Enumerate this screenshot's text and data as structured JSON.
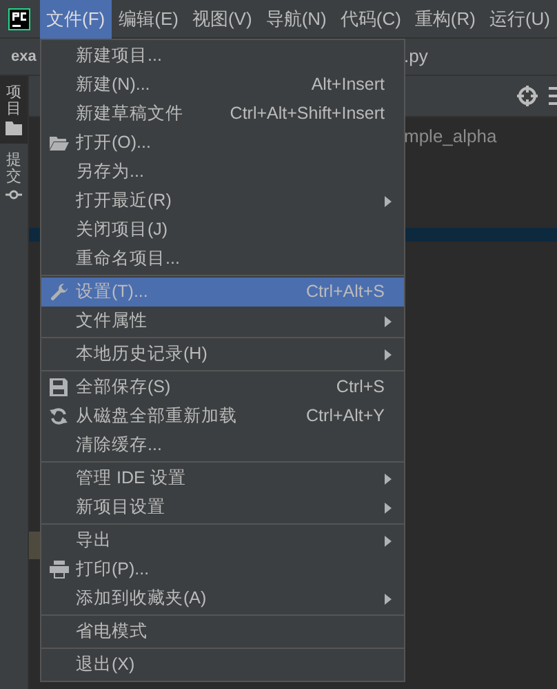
{
  "menu_bar": [
    {
      "label": "文件(F)",
      "selected": true
    },
    {
      "label": "编辑(E)",
      "selected": false
    },
    {
      "label": "视图(V)",
      "selected": false
    },
    {
      "label": "导航(N)",
      "selected": false
    },
    {
      "label": "代码(C)",
      "selected": false
    },
    {
      "label": "重构(R)",
      "selected": false
    },
    {
      "label": "运行(U)",
      "selected": false
    }
  ],
  "editor_tabs": [
    "exa",
    ".py"
  ],
  "tool_strip": [
    {
      "label": "项目",
      "selected": true
    },
    {
      "label": "提交",
      "selected": false
    }
  ],
  "project_tree": {
    "item": "mple_alpha"
  },
  "file_menu": [
    [
      {
        "label": "新建项目...",
        "selected": false,
        "submenu": false
      },
      {
        "label": "新建(N)...",
        "shortcut": "Alt+Insert",
        "selected": false,
        "submenu": false
      },
      {
        "label": "新建草稿文件",
        "shortcut": "Ctrl+Alt+Shift+Insert",
        "selected": false,
        "submenu": false
      },
      {
        "label": "打开(O)...",
        "selected": false,
        "submenu": false
      },
      {
        "label": "另存为...",
        "selected": false,
        "submenu": false
      },
      {
        "label": "打开最近(R)",
        "selected": false,
        "submenu": true
      },
      {
        "label": "关闭项目(J)",
        "selected": false,
        "submenu": false
      },
      {
        "label": "重命名项目...",
        "selected": false,
        "submenu": false
      }
    ],
    [
      {
        "label": "设置(T)...",
        "shortcut": "Ctrl+Alt+S",
        "selected": true,
        "submenu": false
      },
      {
        "label": "文件属性",
        "selected": false,
        "submenu": true
      }
    ],
    [
      {
        "label": "本地历史记录(H)",
        "selected": false,
        "submenu": true
      }
    ],
    [
      {
        "label": "全部保存(S)",
        "shortcut": "Ctrl+S",
        "selected": false,
        "submenu": false
      },
      {
        "label": "从磁盘全部重新加载",
        "shortcut": "Ctrl+Alt+Y",
        "selected": false,
        "submenu": false
      },
      {
        "label": "清除缓存...",
        "selected": false,
        "submenu": false
      }
    ],
    [
      {
        "label": "管理 IDE 设置",
        "selected": false,
        "submenu": true
      },
      {
        "label": "新项目设置",
        "selected": false,
        "submenu": true
      }
    ],
    [
      {
        "label": "导出",
        "selected": false,
        "submenu": true
      },
      {
        "label": "打印(P)...",
        "selected": false,
        "submenu": false
      },
      {
        "label": "添加到收藏夹(A)",
        "selected": false,
        "submenu": true
      }
    ],
    [
      {
        "label": "省电模式",
        "selected": false,
        "submenu": false
      }
    ],
    [
      {
        "label": "退出(X)",
        "selected": false,
        "submenu": false
      }
    ]
  ]
}
